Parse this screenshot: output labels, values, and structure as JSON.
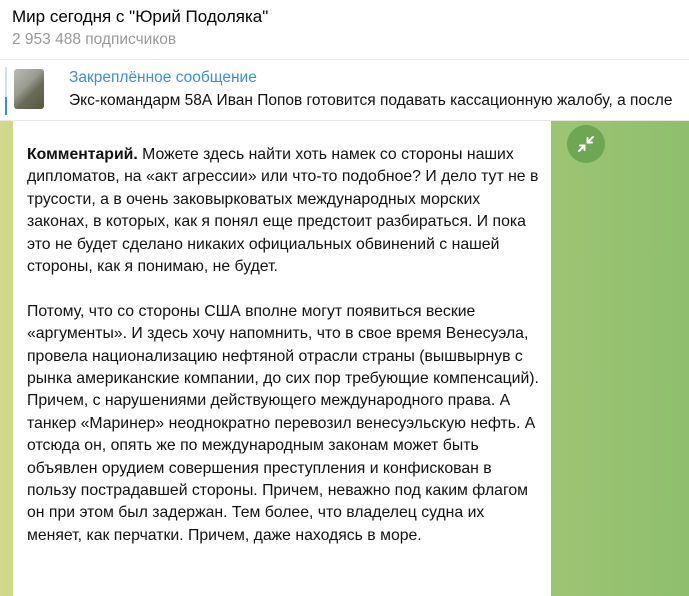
{
  "channel": {
    "title": "Мир сегодня с \"Юрий Подоляка\"",
    "subscribers": "2 953 488 подписчиков"
  },
  "pinned": {
    "label": "Закреплённое сообщение",
    "text": "Экс-командарм 58А Иван Попов готовится подавать кассационную жалобу, а после"
  },
  "message": {
    "bold_prefix": "Комментарий.",
    "p1": " Можете здесь найти хоть намек со стороны наших дипломатов, на «акт агрессии» или что-то подобное? И дело тут не в трусости, а в очень заковыркова­тых международных морских законах, в которых, как я понял еще предстоит разбираться. И пока это не будет сделано никаких официальных обвинений с нашей стороны, как я понимаю, не будет.",
    "p2": "Потому, что со стороны США вполне могут появиться веские «аргументы». И здесь хочу напомнить, что в свое время Венесуэла, провела национализацию нефтяной отрасли страны (вышвырнув с рынка американские компании, до сих пор требующие компенсаций). Причем, с нарушениями действующего международного права. А танкер «Маринер» неоднократно перевозил венесуэльскую нефть. А отсюда он, опять же по международным законам может быть объявлен орудием совершения преступления и конфискован в пользу пострадавшей стороны. Причем, неважно под каким флагом он при этом был задержан. Тем более, что владелец судна их меняет, как перчатки. Причем, даже находясь в море."
  }
}
